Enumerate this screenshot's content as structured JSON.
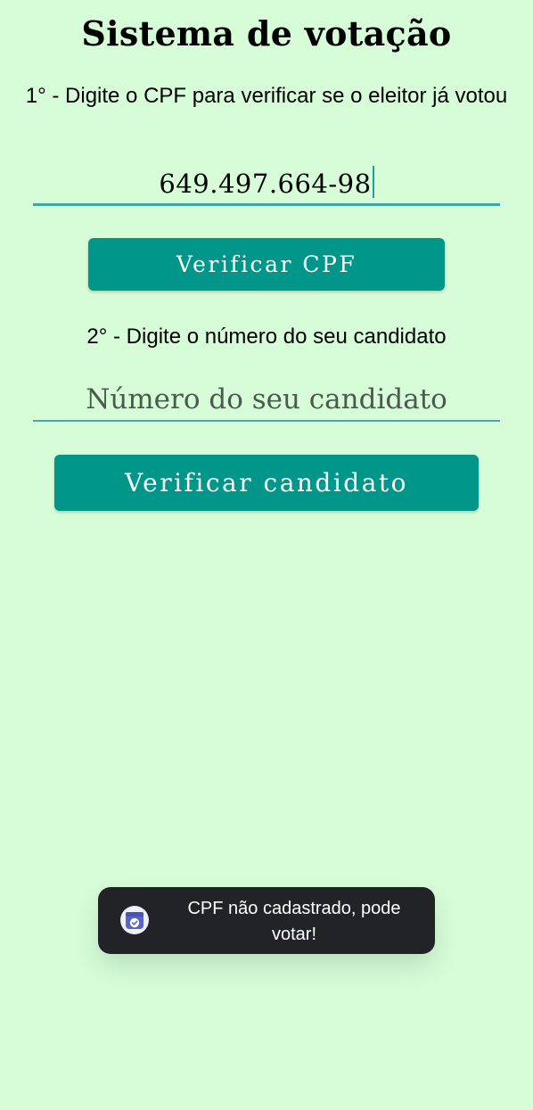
{
  "app": {
    "title": "Sistema de votação"
  },
  "step1": {
    "instruction": "1° - Digite o CPF para verificar se o eleitor já votou",
    "cpf_value": "649.497.664-98",
    "button_label": "Verificar CPF"
  },
  "step2": {
    "instruction": "2° - Digite o número do seu candidato",
    "candidate_placeholder": "Número do seu candidato",
    "candidate_value": "",
    "button_label": "Verificar candidato"
  },
  "toast": {
    "message": "CPF não cadastrado, pode votar!",
    "icon": "app-badge-icon"
  },
  "colors": {
    "background": "#d6fdd8",
    "button": "#00968a",
    "field_underline": "#3aa8a8",
    "toast_background": "#222326",
    "toast_icon": "#5b63c4"
  }
}
